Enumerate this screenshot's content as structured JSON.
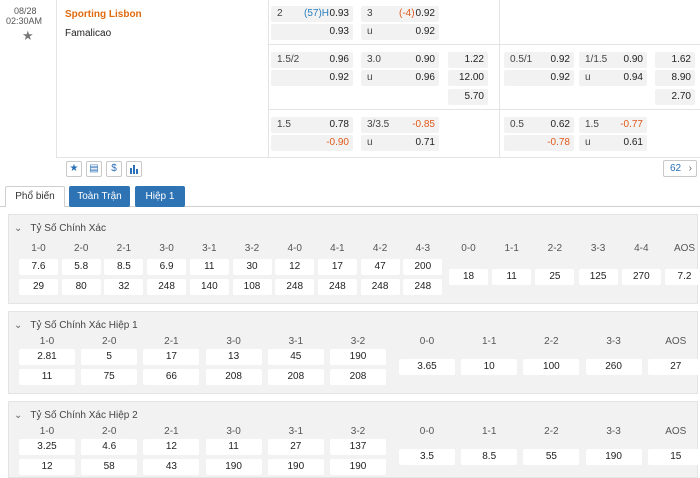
{
  "match": {
    "date": "08/28",
    "time": "02:30AM",
    "home": "Sporting Lisbon",
    "away": "Famalicao"
  },
  "full_time": {
    "row1": {
      "hdp_line": "2",
      "hdp_extra": "(57)H",
      "hdp_home": "0.93",
      "hdp_away": "0.93",
      "ou_line": "3",
      "ou_extra": "(-4)",
      "ou_over": "0.92",
      "ou_under_label": "u",
      "ou_under": "0.92",
      "ou_under_label2": "u"
    },
    "row2": {
      "hdp_line": "1.5/2",
      "hdp_home": "0.96",
      "hdp_away": "0.92",
      "ou_line": "3.0",
      "ou_over": "0.90",
      "ou_under_label": "u",
      "ou_under": "0.96",
      "x1": "1.22",
      "x2": "12.00",
      "x3": "5.70"
    },
    "row3": {
      "hdp_line": "1.5",
      "hdp_home": "0.78",
      "hdp_away": "-0.90",
      "ou_line": "3/3.5",
      "ou_over": "-0.85",
      "ou_under_label": "u",
      "ou_under": "0.71"
    }
  },
  "first_half": {
    "row2": {
      "hdp_line": "0.5/1",
      "hdp_home": "0.92",
      "hdp_away": "0.92",
      "ou_line": "1/1.5",
      "ou_over": "0.90",
      "ou_under_label": "u",
      "ou_under": "0.94",
      "x1": "1.62",
      "x2": "8.90",
      "x3": "2.70"
    },
    "row3": {
      "hdp_line": "0.5",
      "hdp_home": "0.62",
      "hdp_away": "-0.78",
      "ou_line": "1.5",
      "ou_over": "-0.77",
      "ou_under_label": "u",
      "ou_under": "0.61"
    }
  },
  "more_count": "62",
  "tabs": [
    "Phổ biến",
    "Toàn Trận",
    "Hiệp 1"
  ],
  "icons": {
    "star": "star-icon",
    "tv": "tv-icon",
    "dollar": "dollar-icon",
    "chart": "chart-icon"
  },
  "sections": [
    {
      "title": "Tỷ Số Chính Xác",
      "home_headers": [
        "1-0",
        "2-0",
        "2-1",
        "3-0",
        "3-1",
        "3-2",
        "4-0",
        "4-1",
        "4-2",
        "4-3"
      ],
      "home_values": [
        "7.6",
        "5.8",
        "8.5",
        "6.9",
        "11",
        "30",
        "12",
        "17",
        "47",
        "200"
      ],
      "away_values": [
        "29",
        "80",
        "32",
        "248",
        "140",
        "108",
        "248",
        "248",
        "248",
        "248"
      ],
      "draw_headers": [
        "0-0",
        "1-1",
        "2-2",
        "3-3",
        "4-4",
        "AOS"
      ],
      "draw_values": [
        "18",
        "11",
        "25",
        "125",
        "270",
        "7.2"
      ]
    },
    {
      "title": "Tỷ Số Chính Xác Hiệp 1",
      "home_headers": [
        "1-0",
        "2-0",
        "2-1",
        "3-0",
        "3-1",
        "3-2"
      ],
      "home_values": [
        "2.81",
        "5",
        "17",
        "13",
        "45",
        "190"
      ],
      "away_values": [
        "11",
        "75",
        "66",
        "208",
        "208",
        "208"
      ],
      "draw_headers": [
        "0-0",
        "1-1",
        "2-2",
        "3-3",
        "AOS"
      ],
      "draw_values": [
        "3.65",
        "10",
        "100",
        "260",
        "27"
      ]
    },
    {
      "title": "Tỷ Số Chính Xác Hiệp 2",
      "home_headers": [
        "1-0",
        "2-0",
        "2-1",
        "3-0",
        "3-1",
        "3-2"
      ],
      "home_values": [
        "3.25",
        "4.6",
        "12",
        "11",
        "27",
        "137"
      ],
      "away_values": [
        "12",
        "58",
        "43",
        "190",
        "190",
        "190"
      ],
      "draw_headers": [
        "0-0",
        "1-1",
        "2-2",
        "3-3",
        "AOS"
      ],
      "draw_values": [
        "3.5",
        "8.5",
        "55",
        "190",
        "15"
      ]
    }
  ],
  "colors": {
    "home_team": "#e06a10",
    "tab_active_bg": "#2e74b5",
    "accent_blue": "#2a7fbf",
    "negative": "#e05a1b"
  }
}
